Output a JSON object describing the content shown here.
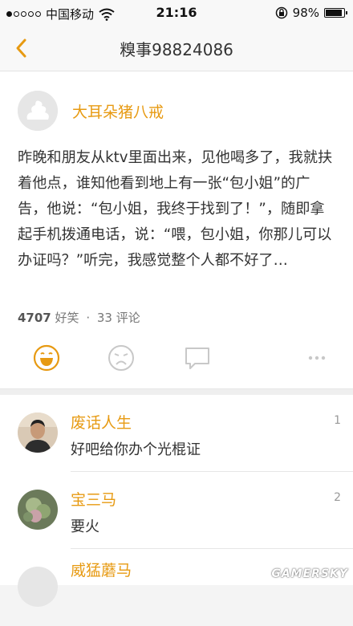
{
  "status_bar": {
    "carrier": "中国移动",
    "time": "21:16",
    "battery_text": "98%",
    "battery_level": 0.98,
    "signal_bars_filled": 1,
    "signal_bars_total": 5
  },
  "nav": {
    "title": "糗事98824086",
    "back_icon": "chevron-left-icon"
  },
  "post": {
    "author": "大耳朵猪八戒",
    "content": "昨晚和朋友从ktv里面出来，见他喝多了，我就扶着他点，谁知他看到地上有一张“包小姐”的广告，他说：“包小姐，我终于找到了！”，随即拿起手机拨通电话，说：“喂，包小姐，你那儿可以办证吗？”听完，我感觉整个人都不好了…",
    "funny_count": "4707",
    "funny_label": "好笑",
    "separator": "·",
    "comment_count": "33",
    "comment_label": "评论",
    "actions": [
      "smile-icon",
      "sad-face-icon",
      "comment-bubble-icon",
      "more-icon"
    ]
  },
  "comments": [
    {
      "name": "废话人生",
      "text": "好吧给你办个光棍证",
      "floor": "1"
    },
    {
      "name": "宝三马",
      "text": "要火",
      "floor": "2"
    },
    {
      "name": "威猛蘑马",
      "text": "",
      "floor": ""
    }
  ],
  "watermark": "GAMERSKY",
  "colors": {
    "accent": "#e79a12",
    "text": "#333333",
    "meta": "#777777",
    "background": "#f4f4f4"
  }
}
